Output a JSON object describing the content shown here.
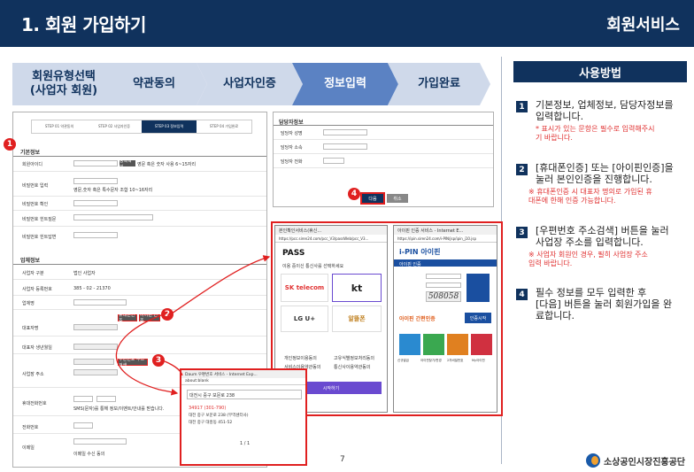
{
  "header": {
    "title": "1. 회원 가입하기",
    "section": "회원서비스"
  },
  "steps": [
    {
      "label1": "회원유형선택",
      "label2": "(사업자 회원)",
      "active": false
    },
    {
      "label1": "약관동의",
      "label2": "",
      "active": false
    },
    {
      "label1": "사업자인증",
      "label2": "",
      "active": false
    },
    {
      "label1": "정보입력",
      "label2": "",
      "active": true
    },
    {
      "label1": "가입완료",
      "label2": "",
      "active": false
    }
  ],
  "howto": {
    "title": "사용방법",
    "items": [
      {
        "n": "1",
        "line1": "기본정보, 업체정보, 담당자정보를",
        "line2": "입력합니다.",
        "note1": "* 표시가 있는 문항은 필수로 입력해주시",
        "note2": "기 바랍니다."
      },
      {
        "n": "2",
        "line1": "[휴대폰인증] 또는 [아이핀인증]을",
        "line2": "눌러 본인인증을 진행합니다.",
        "note1": "※ 휴대폰인증 시 대표자 명의로 가입된 휴",
        "note2": "대폰에 한해 인증 가능합니다."
      },
      {
        "n": "3",
        "line1": "[우편번호 주소검색] 버튼을 눌러",
        "line2": "사업장 주소를 입력합니다.",
        "note1": "※ 사업자 회원인 경우, 필히 사업장 주소",
        "note2": "입력 바랍니다."
      },
      {
        "n": "4",
        "line1": "필수 정보를 모두 입력한 후",
        "line2": "[다음] 버튼을 눌러 회원가입을 완",
        "line3": "료합니다."
      }
    ]
  },
  "form": {
    "substeps": [
      "STEP 01 약관동의",
      "STEP 02 사업자인증",
      "STEP 03 정보입력",
      "STEP 04 가입완료"
    ],
    "basic_title": "기본정보",
    "basic_fields": [
      "회원아이디",
      "비밀번호 입력",
      "비밀번호 확인",
      "비밀번호 힌트질문",
      "비밀번호 힌트답변"
    ],
    "id_btn": "중복확인",
    "id_note": "영문 혹은 숫자 사용 6~15자리",
    "pw_note": "영문,숫자 혹은 특수문자 조합 10~16자리",
    "biz_title": "업체정보",
    "biz_fields": [
      "사업자 구분",
      "사업자 등록번호",
      "업체명",
      "대표자명",
      "대표자 생년월일",
      "사업장 주소",
      "휴대전화번호",
      "전화번호",
      "이메일"
    ],
    "biz_type": "법인 사업자",
    "biz_no": "385 - 02 - 21370",
    "phone_btn": "휴대폰인증",
    "ipin_btn": "아이핀 인증",
    "zip_btn": "우편번호 주소검색",
    "sms_chk": "SMS(문자)를 통해 정보/이벤트/안내를 받습니다.",
    "email_chk": "이메일 수신 동의"
  },
  "contact": {
    "title": "담당자정보",
    "fields": [
      "담당자 성명",
      "담당자 소속",
      "담당자 전화"
    ],
    "next_btn": "다음",
    "cancel_btn": "취소"
  },
  "popup_pass": {
    "title": "본인확인서비스(휴신...",
    "url": "https://pcc.siren24.com/pcc_V3/passWeb/pcc_V3...",
    "brand": "PASS",
    "sub": "이용 중이신 통신사를 선택하세요",
    "carriers": [
      "SK telecom",
      "kt",
      "LG U+",
      "알뜰폰"
    ],
    "agree": [
      "개인정보이용동의",
      "고유식별정보처리동의",
      "서비스이용약관동의",
      "통신사이용약관동의"
    ],
    "start_btn": "시작하기"
  },
  "popup_ipin": {
    "title": "아이핀 인증 서비스 - Internet E...",
    "url": "https://ipin.siren24.com/i-PIN/jsp/ipin_j10.jsp",
    "brand": "i-PIN 아이핀",
    "sub": "아이핀 인증",
    "captcha": "508058",
    "login_btn": "인증시작",
    "links": [
      "신규발급",
      "아이핀찾기/변경",
      "2차비밀번호",
      "My아이핀"
    ],
    "banner": "아이핀 간편인증"
  },
  "popup_zip": {
    "title": "Daum 우편번호 서비스 - Internet Exp...",
    "url": "about:blank",
    "query": "대전시 중구 보문로 238",
    "zipcode": "34917 (301-790)",
    "road": "대전 중구 보문로 238 (무역센터사)",
    "jibun": "대전 중구 대흥동 451-52",
    "pager": "1 / 1"
  },
  "page_number": "7",
  "footer_org": "소상공인시장진흥공단",
  "callouts": [
    "1",
    "2",
    "3",
    "4"
  ]
}
